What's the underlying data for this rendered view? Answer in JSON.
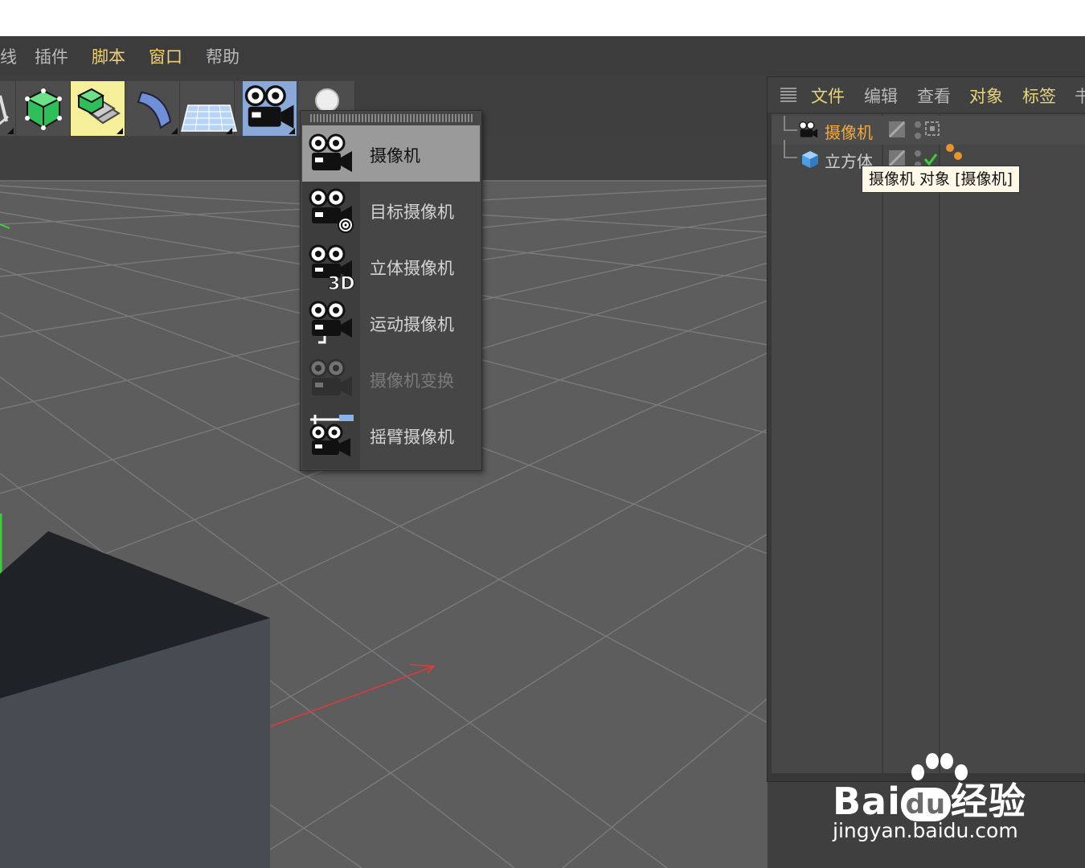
{
  "menubar": {
    "items": [
      "线",
      "插件",
      "脚本",
      "窗口",
      "帮助"
    ]
  },
  "toolbar": {
    "tools": [
      "pen-tool",
      "cube-tool",
      "subdivision-tool",
      "deformer-tool",
      "floor-tool",
      "camera-tool",
      "light-tool"
    ]
  },
  "camera_menu": {
    "items": [
      {
        "label": "摄像机",
        "icon": "camera-icon",
        "state": "hover"
      },
      {
        "label": "目标摄像机",
        "icon": "target-camera-icon",
        "state": "normal"
      },
      {
        "label": "立体摄像机",
        "icon": "stereo-camera-icon",
        "badge": "3D",
        "state": "normal"
      },
      {
        "label": "运动摄像机",
        "icon": "motion-camera-icon",
        "state": "normal"
      },
      {
        "label": "摄像机变换",
        "icon": "camera-morph-icon",
        "state": "disabled"
      },
      {
        "label": "摇臂摄像机",
        "icon": "crane-camera-icon",
        "state": "normal"
      }
    ]
  },
  "object_manager": {
    "menu": [
      "文件",
      "编辑",
      "查看",
      "对象",
      "标签",
      "书"
    ],
    "objects": [
      {
        "name": "摄像机",
        "icon": "camera-icon",
        "selected": true
      },
      {
        "name": "立方体",
        "icon": "cube-icon",
        "selected": false
      }
    ],
    "tooltip": "摄像机 对象 [摄像机]"
  },
  "watermark": {
    "brand": "Bai",
    "brand2": "经验",
    "du": "du",
    "url": "jingyan.baidu.com"
  },
  "colors": {
    "highlight_menu": "#f0d070",
    "object_selected": "#f2a93b",
    "viewport_bg": "#5b5b5b",
    "axis_red": "#e03a3a",
    "axis_green": "#3ad03a"
  }
}
